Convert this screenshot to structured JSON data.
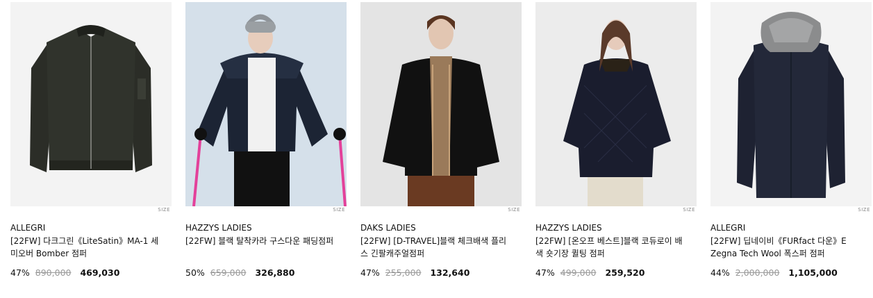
{
  "products": [
    {
      "brand": "ALLEGRI",
      "name": "[22FW] 다크그린《LiteSatin》MA-1 세미오버 Bomber 점퍼",
      "discount": "47%",
      "original_price": "890,000",
      "sale_price": "469,030",
      "size_label": "SIZE",
      "image": "green-bomber-jacket"
    },
    {
      "brand": "HAZZYS LADIES",
      "name": "[22FW] 블랙 탈착카라 구스다운 패딩점퍼",
      "discount": "50%",
      "original_price": "659,000",
      "sale_price": "326,880",
      "size_label": "SIZE",
      "image": "navy-down-padding-model"
    },
    {
      "brand": "DAKS LADIES",
      "name": "[22FW] [D-TRAVEL]블랙 체크배색 플리스 긴팔캐주얼점퍼",
      "discount": "47%",
      "original_price": "255,000",
      "sale_price": "132,640",
      "size_label": "SIZE",
      "image": "black-fleece-jacket-model"
    },
    {
      "brand": "HAZZYS LADIES",
      "name": "[22FW] [온오프 베스트]블랙 코듀로이 배색 숏기장 퀼팅 점퍼",
      "discount": "47%",
      "original_price": "499,000",
      "sale_price": "259,520",
      "size_label": "SIZE",
      "image": "navy-quilted-jacket-model"
    },
    {
      "brand": "ALLEGRI",
      "name": "[22FW] 딥네이비《FURfact 다운》E Zegna Tech Wool 폭스퍼 점퍼",
      "discount": "44%",
      "original_price": "2,000,000",
      "sale_price": "1,105,000",
      "size_label": "SIZE",
      "image": "navy-fox-fur-coat"
    }
  ]
}
